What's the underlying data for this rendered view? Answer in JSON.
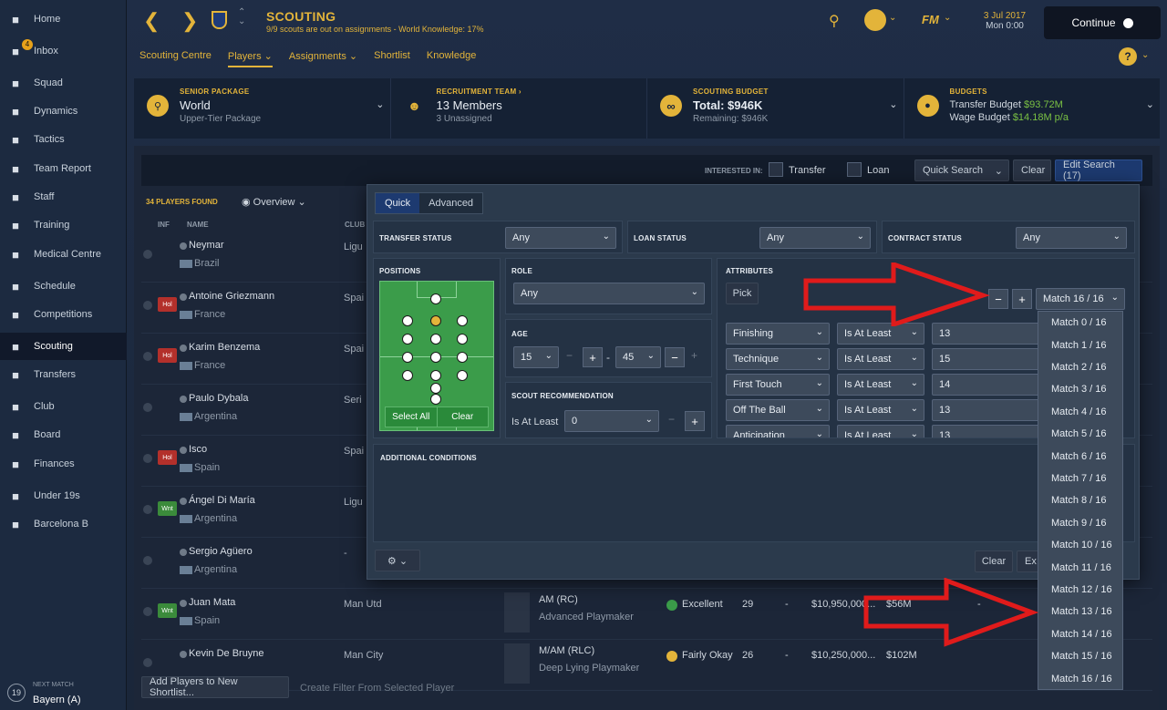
{
  "sidebar": {
    "items": [
      {
        "label": "Home",
        "icon": "home-icon"
      },
      {
        "label": "Inbox",
        "icon": "inbox-icon",
        "badge": "4"
      },
      {
        "label": "Squad",
        "icon": "squad-icon"
      },
      {
        "label": "Dynamics",
        "icon": "dynamics-icon"
      },
      {
        "label": "Tactics",
        "icon": "tactics-icon"
      },
      {
        "label": "Team Report",
        "icon": "report-icon"
      },
      {
        "label": "Staff",
        "icon": "staff-icon"
      },
      {
        "label": "Training",
        "icon": "training-icon"
      },
      {
        "label": "Medical Centre",
        "icon": "medical-icon"
      },
      {
        "label": "Schedule",
        "icon": "schedule-icon"
      },
      {
        "label": "Competitions",
        "icon": "trophy-icon"
      },
      {
        "label": "Scouting",
        "icon": "search-icon"
      },
      {
        "label": "Transfers",
        "icon": "transfers-icon"
      },
      {
        "label": "Club",
        "icon": "club-icon"
      },
      {
        "label": "Board",
        "icon": "board-icon"
      },
      {
        "label": "Finances",
        "icon": "finances-icon"
      },
      {
        "label": "Under 19s",
        "icon": "u19-icon"
      },
      {
        "label": "Barcelona B",
        "icon": "reserve-icon"
      }
    ],
    "next_match": {
      "label": "NEXT MATCH",
      "opponent": "Bayern (A)",
      "day": "19"
    }
  },
  "header": {
    "title": "SCOUTING",
    "subtitle": "9/9 scouts are out on assignments - World Knowledge: 17%",
    "date": "3 Jul 2017",
    "time": "Mon 0:00",
    "continue": "Continue",
    "fm": "FM"
  },
  "tabs": [
    "Scouting Centre",
    "Players",
    "Assignments",
    "Shortlist",
    "Knowledge"
  ],
  "panels": [
    {
      "label": "SENIOR PACKAGE",
      "value": "World",
      "sub": "Upper-Tier Package"
    },
    {
      "label": "RECRUITMENT TEAM",
      "value": "13 Members",
      "sub": "3 Unassigned"
    },
    {
      "label": "SCOUTING BUDGET",
      "value": "Total: $946K",
      "sub": "Remaining: $946K"
    },
    {
      "label": "BUDGETS",
      "line1": "Transfer Budget",
      "line1_val": "$93.72M",
      "line2": "Wage Budget",
      "line2_val": "$14.18M p/a"
    }
  ],
  "filters": {
    "interested_in": "INTERESTED IN:",
    "transfer": "Transfer",
    "loan": "Loan",
    "quick_search": "Quick Search",
    "clear": "Clear",
    "edit_search": "Edit Search (17)"
  },
  "list": {
    "players_found": "34 PLAYERS FOUND",
    "view": "Overview",
    "col_inf": "INF",
    "col_name": "NAME",
    "col_club": "CLUB",
    "rows": [
      {
        "name": "Neymar",
        "nation": "Brazil",
        "club": "Ligu",
        "tag": ""
      },
      {
        "name": "Antoine Griezmann",
        "nation": "France",
        "club": "Spai",
        "tag": "Hol"
      },
      {
        "name": "Karim Benzema",
        "nation": "France",
        "club": "Spai",
        "tag": "Hol"
      },
      {
        "name": "Paulo Dybala",
        "nation": "Argentina",
        "club": "Seri",
        "tag": ""
      },
      {
        "name": "Isco",
        "nation": "Spain",
        "club": "Spai",
        "tag": "Hol"
      },
      {
        "name": "Ángel Di María",
        "nation": "Argentina",
        "club": "Ligu",
        "tag": "Wnt"
      },
      {
        "name": "Sergio Agüero",
        "nation": "Argentina",
        "club": "-",
        "tag": ""
      },
      {
        "name": "Juan Mata",
        "nation": "Spain",
        "club": "Man Utd",
        "tag": "Wnt",
        "pos": "AM (RC)",
        "role": "Advanced Playmaker",
        "rec": "Excellent",
        "age": "29",
        "dash": "-",
        "wage": "$10,950,000...",
        "value": "$56M",
        "extra": "-"
      },
      {
        "name": "Kevin De Bruyne",
        "nation": "",
        "club": "Man City",
        "tag": "",
        "pos": "M/AM (RLC)",
        "role": "Deep Lying Playmaker",
        "rec": "Fairly Okay",
        "age": "26",
        "dash": "-",
        "wage": "$10,250,000...",
        "value": "$102M",
        "extra": ""
      }
    ],
    "add_shortlist": "Add Players to New Shortlist...",
    "create_filter": "Create Filter From Selected Player"
  },
  "search": {
    "tab_quick": "Quick",
    "tab_advanced": "Advanced",
    "transfer_status": {
      "label": "TRANSFER STATUS",
      "value": "Any"
    },
    "loan_status": {
      "label": "LOAN STATUS",
      "value": "Any"
    },
    "contract_status": {
      "label": "CONTRACT STATUS",
      "value": "Any"
    },
    "positions": {
      "label": "POSITIONS",
      "select_all": "Select All",
      "clear": "Clear"
    },
    "role": {
      "label": "ROLE",
      "value": "Any"
    },
    "age": {
      "label": "AGE",
      "min": "15",
      "max": "45",
      "sep": "-"
    },
    "scout": {
      "label": "SCOUT RECOMMENDATION",
      "cond": "Is At Least",
      "value": "0"
    },
    "attributes": {
      "label": "ATTRIBUTES",
      "pick": "Pick",
      "match": "Match 16 / 16",
      "rows": [
        {
          "attr": "Finishing",
          "cond": "Is At Least",
          "value": "13"
        },
        {
          "attr": "Technique",
          "cond": "Is At Least",
          "value": "15"
        },
        {
          "attr": "First Touch",
          "cond": "Is At Least",
          "value": "14"
        },
        {
          "attr": "Off The Ball",
          "cond": "Is At Least",
          "value": "13"
        },
        {
          "attr": "Anticipation",
          "cond": "Is At Least",
          "value": "13"
        }
      ]
    },
    "additional": "ADDITIONAL CONDITIONS",
    "clear": "Clear",
    "exit": "Ex"
  },
  "match_menu": [
    "Match 0 / 16",
    "Match 1 / 16",
    "Match 2 / 16",
    "Match 3 / 16",
    "Match 4 / 16",
    "Match 5 / 16",
    "Match 6 / 16",
    "Match 7 / 16",
    "Match 8 / 16",
    "Match 9 / 16",
    "Match 10 / 16",
    "Match 11 / 16",
    "Match 12 / 16",
    "Match 13 / 16",
    "Match 14 / 16",
    "Match 15 / 16",
    "Match 16 / 16"
  ],
  "colors": {
    "accent": "#e3b43a",
    "arrow": "#e01b1b",
    "pitch": "#3b9c4a",
    "active_tab": "#1d3a70",
    "green": "#7ac143"
  }
}
